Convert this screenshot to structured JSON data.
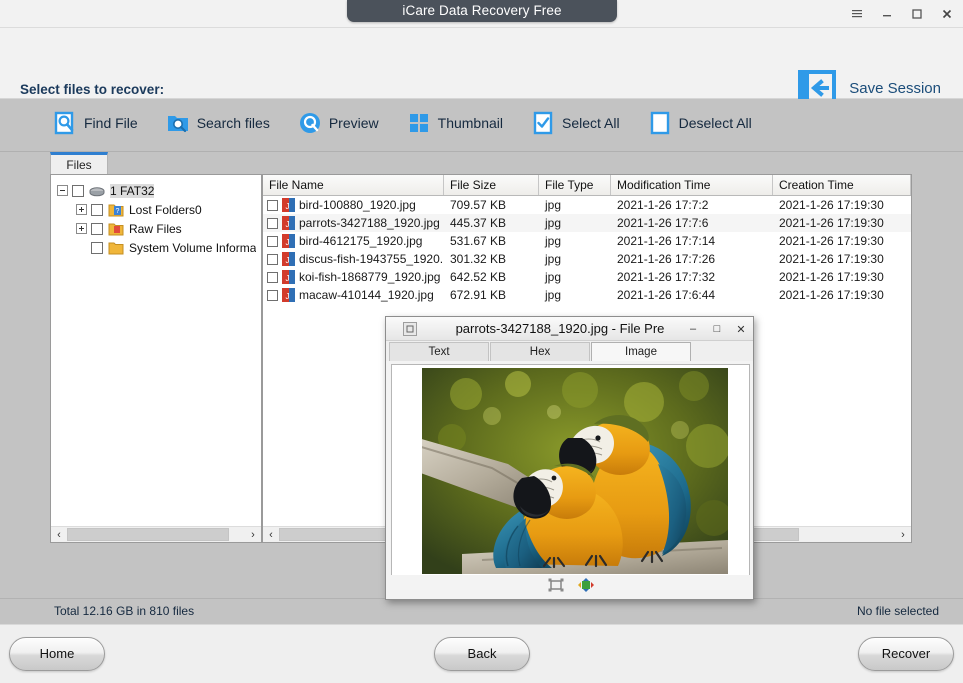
{
  "window": {
    "title": "iCare Data Recovery Free",
    "controls": [
      {
        "name": "menu-icon",
        "glyph": "≡"
      },
      {
        "name": "minimize-icon",
        "glyph": "–"
      },
      {
        "name": "maximize-icon",
        "glyph": "□"
      },
      {
        "name": "close-icon",
        "glyph": "✕"
      }
    ]
  },
  "header": {
    "title": "Select files to recover:",
    "save_session_label": "Save Session",
    "save_icon": "save-session-icon",
    "accent_color": "#2f9ae8"
  },
  "toolbar": {
    "items": [
      {
        "label": "Find File",
        "icon": "find-file-icon"
      },
      {
        "label": "Search files",
        "icon": "search-files-icon"
      },
      {
        "label": "Preview",
        "icon": "preview-icon"
      },
      {
        "label": "Thumbnail",
        "icon": "thumbnail-icon"
      },
      {
        "label": "Select All",
        "icon": "select-all-icon"
      },
      {
        "label": "Deselect All",
        "icon": "deselect-all-icon"
      }
    ]
  },
  "tabs": {
    "files_tab": "Files"
  },
  "tree": {
    "nodes": [
      {
        "label": "1 FAT32",
        "level": 1,
        "expander": "minus",
        "icon": "drive-icon",
        "selected": true
      },
      {
        "label": "Lost Folders0",
        "level": 2,
        "expander": "plus",
        "icon": "lost-folder-icon",
        "selected": false
      },
      {
        "label": "Raw Files",
        "level": 2,
        "expander": "plus",
        "icon": "raw-folder-icon",
        "selected": false
      },
      {
        "label": "System Volume Informa",
        "level": 2,
        "expander": "none",
        "icon": "folder-icon",
        "selected": false
      }
    ]
  },
  "file_list": {
    "columns": [
      {
        "label": "File Name",
        "width": 181
      },
      {
        "label": "File Size",
        "width": 95
      },
      {
        "label": "File Type",
        "width": 72
      },
      {
        "label": "Modification Time",
        "width": 162
      },
      {
        "label": "Creation Time",
        "width": 138
      }
    ],
    "rows": [
      {
        "name": "bird-100880_1920.jpg",
        "size": "709.57 KB",
        "type": "jpg",
        "modified": "2021-1-26 17:7:2",
        "created": "2021-1-26 17:19:30",
        "checked": false
      },
      {
        "name": "parrots-3427188_1920.jpg",
        "size": "445.37 KB",
        "type": "jpg",
        "modified": "2021-1-26 17:7:6",
        "created": "2021-1-26 17:19:30",
        "checked": false
      },
      {
        "name": "bird-4612175_1920.jpg",
        "size": "531.67 KB",
        "type": "jpg",
        "modified": "2021-1-26 17:7:14",
        "created": "2021-1-26 17:19:30",
        "checked": false
      },
      {
        "name": "discus-fish-1943755_1920...",
        "size": "301.32 KB",
        "type": "jpg",
        "modified": "2021-1-26 17:7:26",
        "created": "2021-1-26 17:19:30",
        "checked": false
      },
      {
        "name": "koi-fish-1868779_1920.jpg",
        "size": "642.52 KB",
        "type": "jpg",
        "modified": "2021-1-26 17:7:32",
        "created": "2021-1-26 17:19:30",
        "checked": false
      },
      {
        "name": "macaw-410144_1920.jpg",
        "size": "672.91 KB",
        "type": "jpg",
        "modified": "2021-1-26 17:6:44",
        "created": "2021-1-26 17:19:30",
        "checked": false
      }
    ]
  },
  "preview_dialog": {
    "caption": "parrots-3427188_1920.jpg - File Pre",
    "sys_icon": "restore-icon",
    "controls": [
      {
        "name": "minimize-icon",
        "glyph": "–"
      },
      {
        "name": "maximize-icon",
        "glyph": "□"
      },
      {
        "name": "close-icon",
        "glyph": "✕"
      }
    ],
    "tabs": [
      {
        "label": "Text",
        "active": false
      },
      {
        "label": "Hex",
        "active": false
      },
      {
        "label": "Image",
        "active": true
      }
    ],
    "image_alt": "two blue-and-gold macaws perched on a branch",
    "bottom_tools": [
      {
        "name": "fit-to-window-icon"
      },
      {
        "name": "actual-size-icon"
      }
    ]
  },
  "status": {
    "left": "Total 12.16 GB in 810 files",
    "right": "No file selected"
  },
  "footer": {
    "home": "Home",
    "back": "Back",
    "recover": "Recover"
  },
  "scrollbars": {
    "left_arrow": "‹",
    "right_arrow": "›"
  }
}
